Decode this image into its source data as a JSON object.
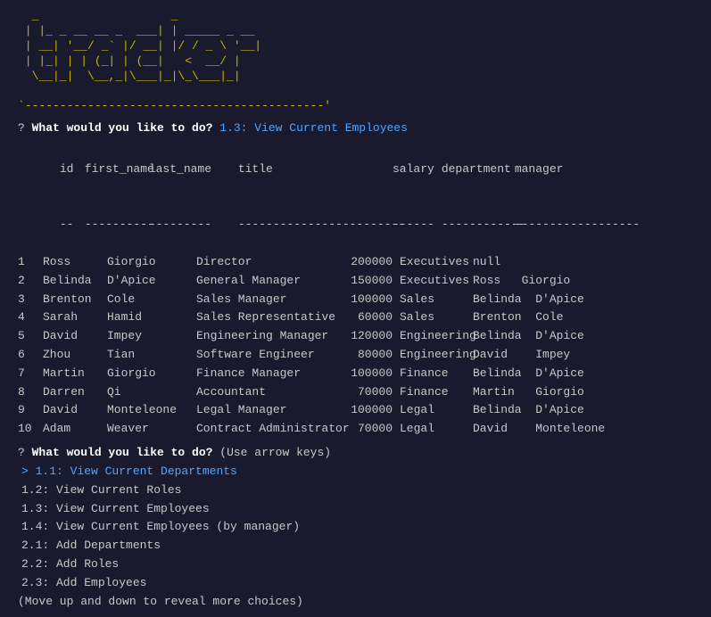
{
  "logo": {
    "lines": [
      " _                   _",
      "| |_ _ __ __ _  ___| | _____ _ __",
      "| __| '__/ _` |/ __| |/ / _ \\ '__|",
      "| |_| | | (_| | (__|   <  __/ |",
      " \\__|_|  \\__,_|\\___|_|\\_\\___|_|",
      "",
      "-------------------------------------------"
    ]
  },
  "initial_prompt": {
    "question": "What would you like to do?",
    "selection": "1.3: View Current Employees"
  },
  "table": {
    "headers": [
      "id",
      "first_name",
      "last_name",
      "title",
      "salary",
      "department",
      "manager"
    ],
    "dividers": [
      "--",
      "----------",
      "---------",
      "------------------------",
      "------",
      "------------",
      "------------------"
    ],
    "rows": [
      {
        "id": "1",
        "first_name": "Ross",
        "last_name": "Giorgio",
        "title": "Director",
        "salary": "200000",
        "department": "Executives",
        "manager": "null"
      },
      {
        "id": "2",
        "first_name": "Belinda",
        "last_name": "D'Apice",
        "title": "General Manager",
        "salary": "150000",
        "department": "Executives",
        "manager": "Ross   Giorgio"
      },
      {
        "id": "3",
        "first_name": "Brenton",
        "last_name": "Cole",
        "title": "Sales Manager",
        "salary": "100000",
        "department": "Sales",
        "manager": "Belinda  D'Apice"
      },
      {
        "id": "4",
        "first_name": "Sarah",
        "last_name": "Hamid",
        "title": "Sales Representative",
        "salary": "60000",
        "department": "Sales",
        "manager": "Brenton  Cole"
      },
      {
        "id": "5",
        "first_name": "David",
        "last_name": "Impey",
        "title": "Engineering Manager",
        "salary": "120000",
        "department": "Engineering",
        "manager": "Belinda  D'Apice"
      },
      {
        "id": "6",
        "first_name": "Zhou",
        "last_name": "Tian",
        "title": "Software Engineer",
        "salary": "80000",
        "department": "Engineering",
        "manager": "David    Impey"
      },
      {
        "id": "7",
        "first_name": "Martin",
        "last_name": "Giorgio",
        "title": "Finance Manager",
        "salary": "100000",
        "department": "Finance",
        "manager": "Belinda  D'Apice"
      },
      {
        "id": "8",
        "first_name": "Darren",
        "last_name": "Qi",
        "title": "Accountant",
        "salary": "70000",
        "department": "Finance",
        "manager": "Martin   Giorgio"
      },
      {
        "id": "9",
        "first_name": "David",
        "last_name": "Monteleone",
        "title": "Legal Manager",
        "salary": "100000",
        "department": "Legal",
        "manager": "Belinda  D'Apice"
      },
      {
        "id": "10",
        "first_name": "Adam",
        "last_name": "Weaver",
        "title": "Contract Administrator",
        "salary": "70000",
        "department": "Legal",
        "manager": "David    Monteleone"
      }
    ]
  },
  "menu": {
    "prompt_question": "What would you like to do?",
    "prompt_hint": "(Use arrow keys)",
    "selected_item": "1.1: View Current Departments",
    "items": [
      "1.1: View Current Departments",
      "1.2: View Current Roles",
      "1.3: View Current Employees",
      "1.4: View Current Employees (by manager)",
      "2.1: Add Departments",
      "2.2: Add Roles",
      "2.3: Add Employees"
    ],
    "scroll_hint": "(Move up and down to reveal more choices)"
  }
}
